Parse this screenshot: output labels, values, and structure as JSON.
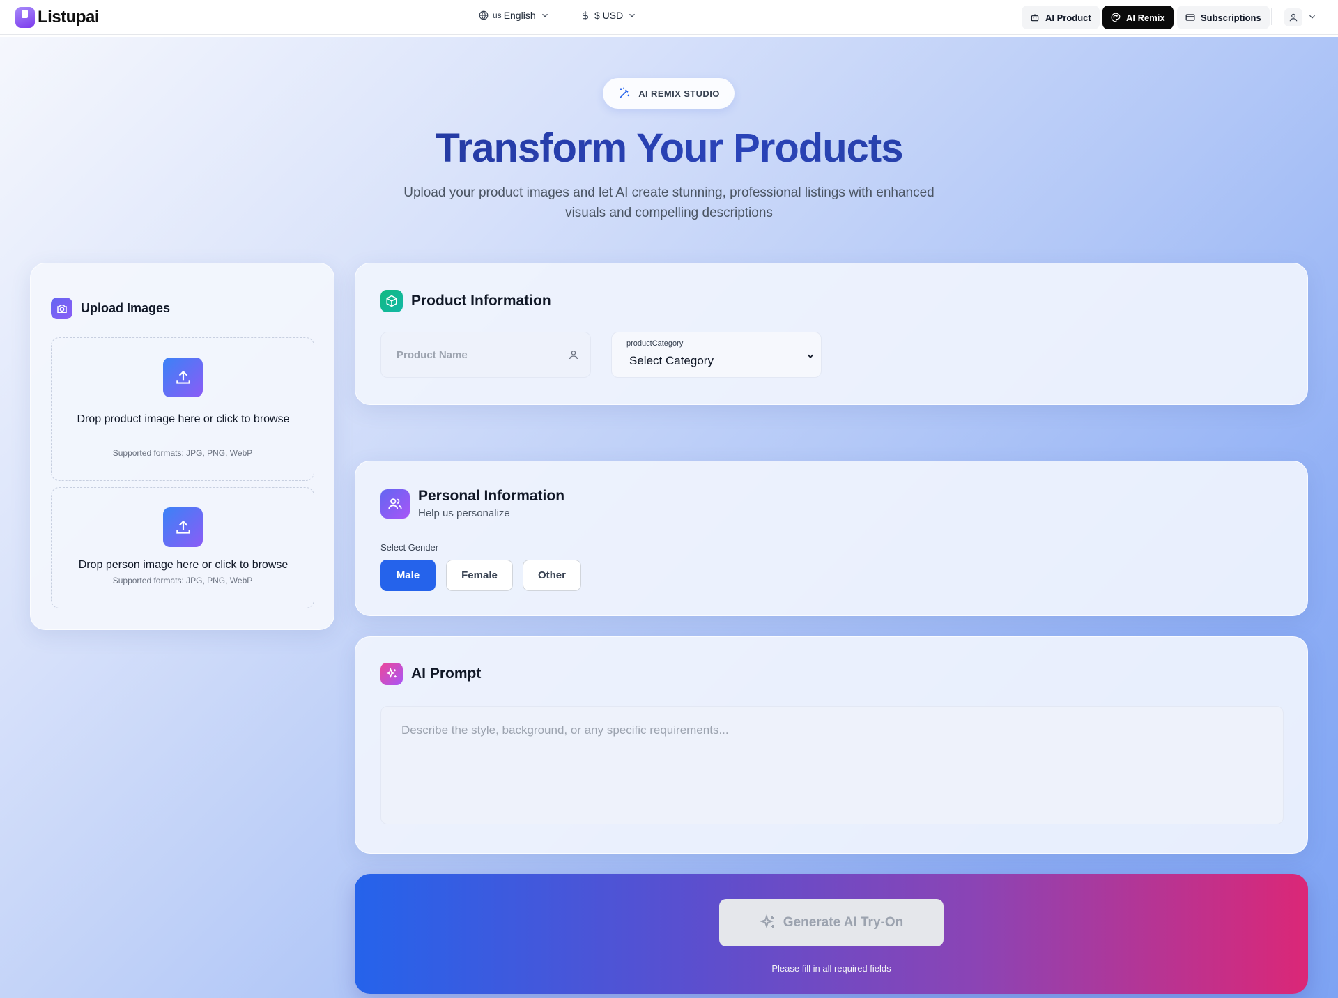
{
  "header": {
    "logo_text": "Listupai",
    "language": {
      "prefix": "us",
      "label": "English"
    },
    "currency": {
      "label": "$ USD"
    },
    "nav": {
      "ai_product": "AI Product",
      "ai_remix": "AI Remix",
      "subscriptions": "Subscriptions"
    },
    "active_nav": "AI Remix"
  },
  "hero": {
    "badge": "AI REMIX STUDIO",
    "title": "Transform Your Products",
    "subtitle": "Upload your product images and let AI create stunning, professional listings with enhanced visuals and compelling descriptions"
  },
  "upload": {
    "title": "Upload Images",
    "product_drop": {
      "label": "Drop product image here or click to browse",
      "formats": "Supported formats: JPG, PNG, WebP"
    },
    "person_drop": {
      "label": "Drop person image here or click to browse",
      "formats": "Supported formats: JPG, PNG, WebP"
    }
  },
  "product_info": {
    "title": "Product Information",
    "name_placeholder": "Product Name",
    "category_label": "productCategory",
    "category_value": "Select Category"
  },
  "personal_info": {
    "title": "Personal Information",
    "subtitle": "Help us personalize",
    "gender_label": "Select Gender",
    "genders": [
      "Male",
      "Female",
      "Other"
    ],
    "selected_gender": "Male"
  },
  "ai_prompt": {
    "title": "AI Prompt",
    "placeholder": "Describe the style, background, or any specific requirements..."
  },
  "generate": {
    "button_label": "Generate AI Try-On",
    "note": "Please fill in all required fields",
    "enabled": false
  },
  "colors": {
    "primary_blue": "#2563eb",
    "title_navy": "#1e3a8a",
    "gradient_end_pink": "#db2777",
    "active_nav_bg": "#0b0b0b"
  }
}
